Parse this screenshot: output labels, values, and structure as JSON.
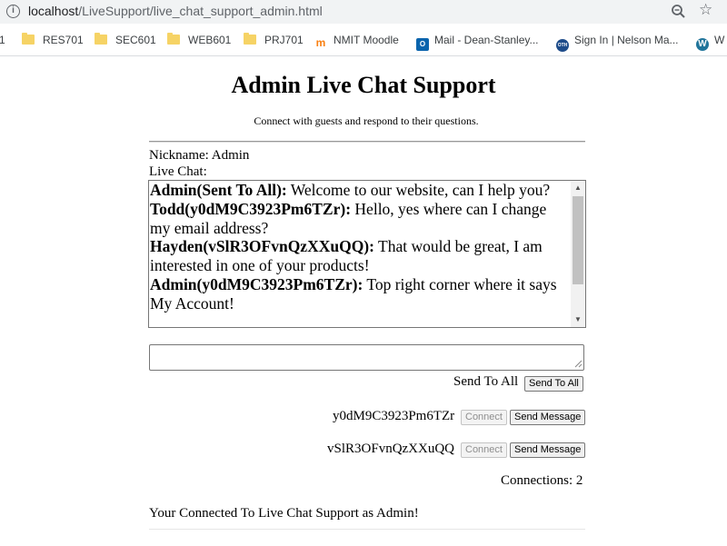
{
  "browser": {
    "url_host": "localhost",
    "url_path": "/LiveSupport/live_chat_support_admin.html",
    "bookmarks": [
      {
        "label": "1",
        "icon": "folder-icon"
      },
      {
        "label": "RES701",
        "icon": "folder-icon"
      },
      {
        "label": "SEC601",
        "icon": "folder-icon"
      },
      {
        "label": "WEB601",
        "icon": "folder-icon"
      },
      {
        "label": "PRJ701",
        "icon": "folder-icon"
      },
      {
        "label": "NMIT Moodle",
        "icon": "moodle-icon"
      },
      {
        "label": "Mail - Dean-Stanley...",
        "icon": "outlook-icon"
      },
      {
        "label": "Sign In | Nelson Ma...",
        "icon": "oth-icon"
      },
      {
        "label": "W",
        "icon": "wordpress-icon"
      }
    ]
  },
  "page": {
    "title": "Admin Live Chat Support",
    "subtitle": "Connect with guests and respond to their questions.",
    "nickname_label": "Nickname: Admin",
    "live_chat_label": "Live Chat:"
  },
  "chat": {
    "messages": [
      {
        "sender": "Admin(Sent To All):",
        "text": " Welcome to our website, can I help you?"
      },
      {
        "sender": "Todd(y0dM9C3923Pm6TZr):",
        "text": " Hello, yes where can I change my email address?"
      },
      {
        "sender": "Hayden(vSlR3OFvnQzXXuQQ):",
        "text": " That would be great, I am interested in one of your products!"
      },
      {
        "sender": "Admin(y0dM9C3923Pm6TZr):",
        "text": " Top right corner where it says My Account!"
      }
    ]
  },
  "send_all": {
    "label": "Send To All",
    "button": "Send To All"
  },
  "clients": [
    {
      "id": "y0dM9C3923Pm6TZr",
      "connect_button": "Connect",
      "send_button": "Send Message"
    },
    {
      "id": "vSlR3OFvnQzXXuQQ",
      "connect_button": "Connect",
      "send_button": "Send Message"
    }
  ],
  "connections": "Connections: 2",
  "status": "Your Connected To Live Chat Support as Admin!",
  "colors": {
    "chrome_bg": "#f1f3f4",
    "folder": "#f6d365",
    "button_bg": "#efefef"
  }
}
